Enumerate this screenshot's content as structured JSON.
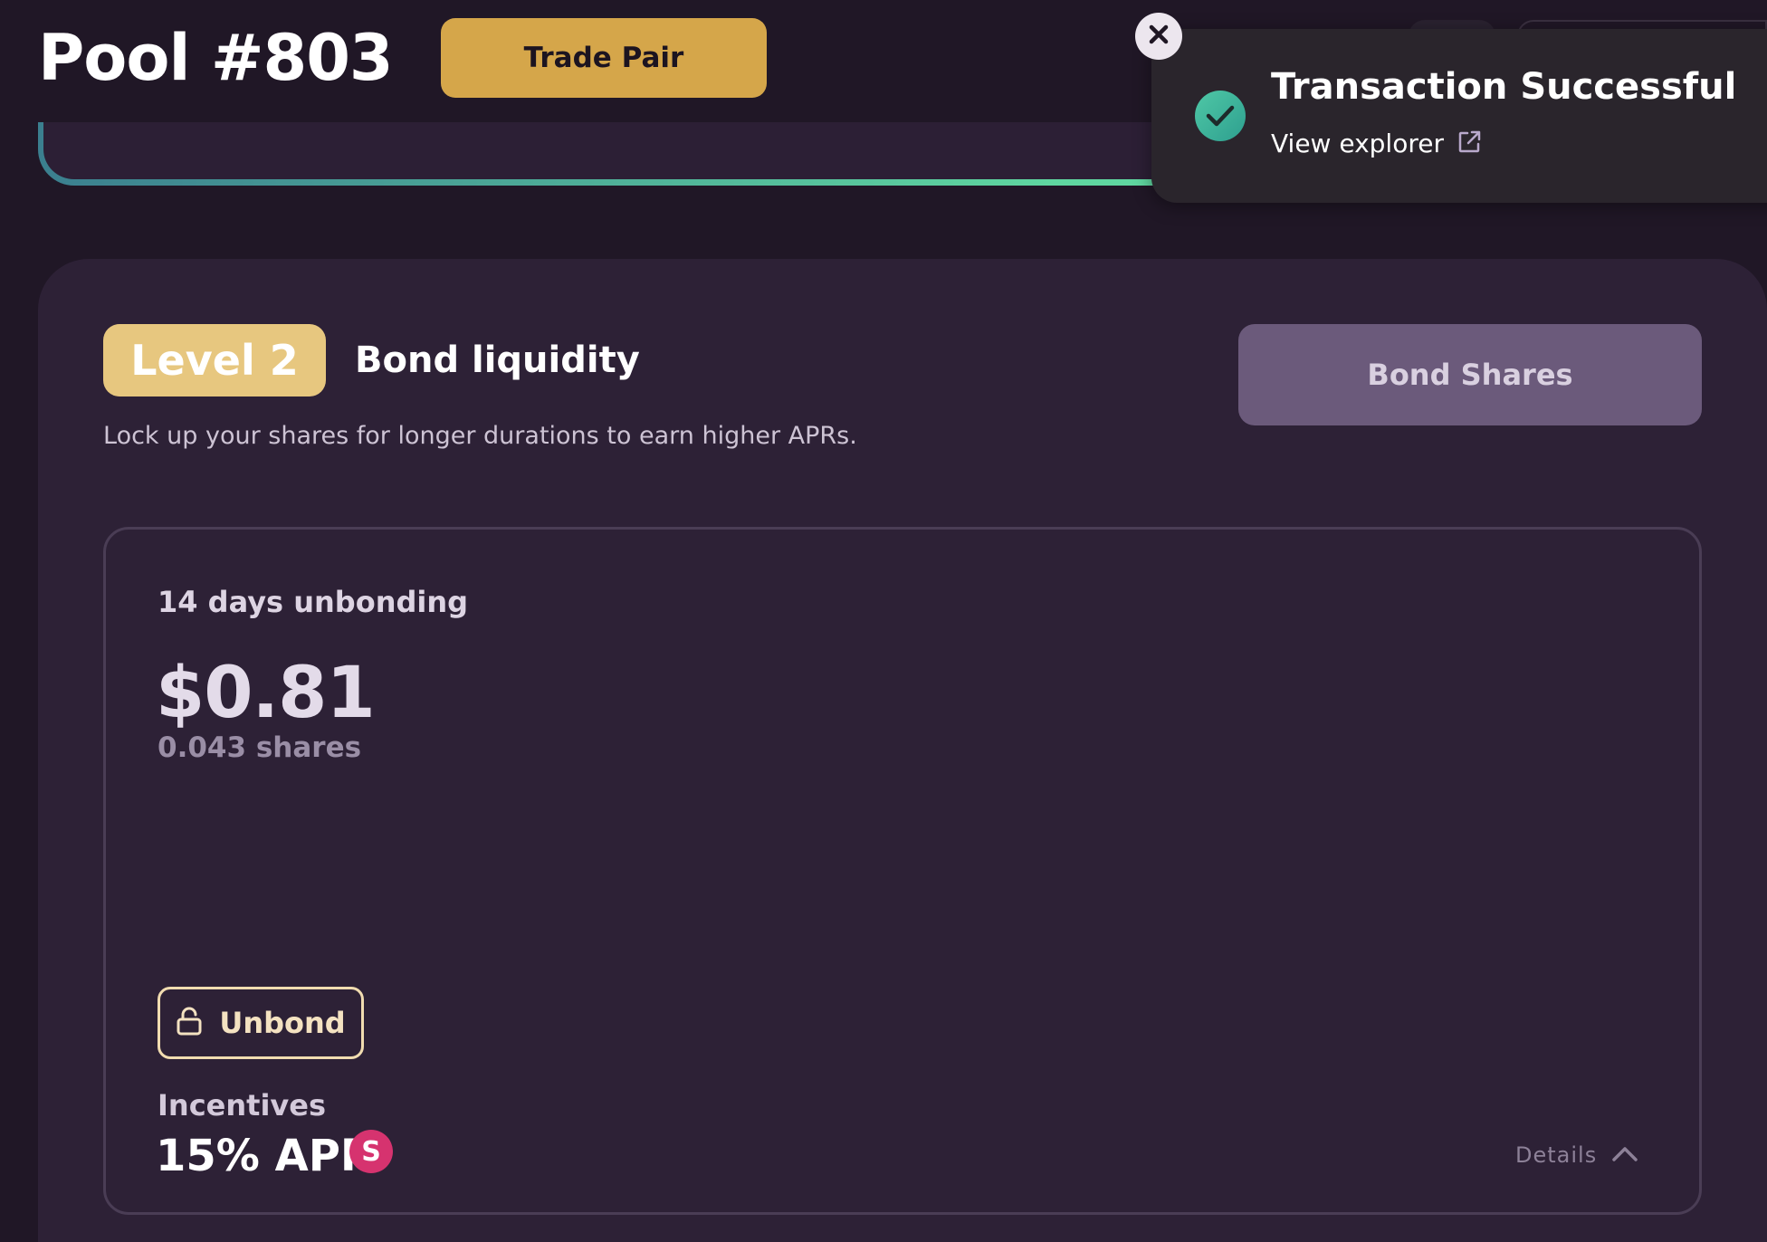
{
  "header": {
    "pool_title": "Pool #803",
    "trade_button_label": "Trade Pair"
  },
  "bond_section": {
    "level_badge": "Level 2",
    "heading": "Bond liquidity",
    "description": "Lock up your shares for longer durations to earn higher APRs.",
    "bond_shares_button_label": "Bond Shares"
  },
  "bond_card": {
    "unbonding_label": "14 days unbonding",
    "usd_value": "$0.81",
    "shares_value": "0.043 shares",
    "unbond_button_label": "Unbond",
    "incentives_label": "Incentives",
    "apr_value": "15% APR",
    "token_icon_letter": "S",
    "details_label": "Details"
  },
  "toast": {
    "title": "Transaction Successful",
    "link_label": "View explorer"
  },
  "colors": {
    "background": "#201726",
    "card": "#2d2136",
    "trade_button": "#d5a64a",
    "level_badge": "#e7c77f",
    "bond_shares_button": "#6b5a7b",
    "unbond_border": "#f1dcb0",
    "token_icon": "#d6336f",
    "success": "#3fb59a"
  },
  "icons": {
    "close": "close-icon",
    "success": "check-circle-icon",
    "external": "external-link-icon",
    "unlock": "unlock-icon",
    "chevron": "chevron-up-icon"
  }
}
